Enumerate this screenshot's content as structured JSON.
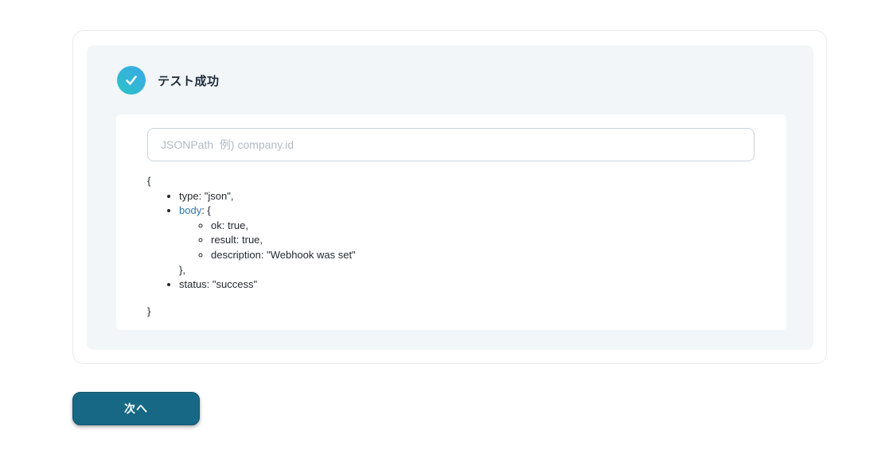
{
  "status": {
    "title": "テスト成功",
    "icon": "check-circle-icon",
    "icon_gradient_start": "#2bc4c6",
    "icon_gradient_end": "#3ba7e8"
  },
  "jsonpath_input": {
    "value": "",
    "placeholder": "JSONPath  例) company.id"
  },
  "json_tree": {
    "open_brace": "{",
    "type_entry": "type: \"json\",",
    "body_key": "body",
    "body_open": ": {",
    "body_children": [
      "ok: true,",
      "result: true,",
      "description: \"Webhook was set\""
    ],
    "body_close": "},",
    "status_entry": "status: \"success\"",
    "close_brace": "}",
    "key_color": "#2878a8"
  },
  "next_button": {
    "label": "次へ",
    "background": "#166885"
  }
}
